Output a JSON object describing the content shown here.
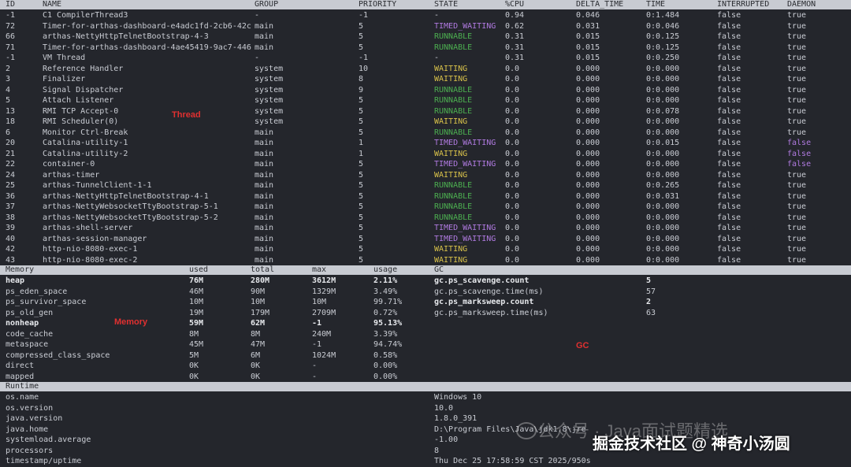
{
  "thread": {
    "headers": [
      "ID",
      "NAME",
      "GROUP",
      "PRIORITY",
      "STATE",
      "%CPU",
      "DELTA_TIME",
      "TIME",
      "INTERRUPTED",
      "DAEMON"
    ],
    "rows": [
      [
        "-1",
        "C1 CompilerThread3",
        "-",
        "-1",
        "-",
        "0.94",
        "0.046",
        "0:1.484",
        "false",
        "true"
      ],
      [
        "72",
        "Timer-for-arthas-dashboard-e4adc1fd-2cb6-42c",
        "main",
        "5",
        "TIMED_WAITING",
        "0.62",
        "0.031",
        "0:0.046",
        "false",
        "true"
      ],
      [
        "66",
        "arthas-NettyHttpTelnetBootstrap-4-3",
        "main",
        "5",
        "RUNNABLE",
        "0.31",
        "0.015",
        "0:0.125",
        "false",
        "true"
      ],
      [
        "71",
        "Timer-for-arthas-dashboard-4ae45419-9ac7-446",
        "main",
        "5",
        "RUNNABLE",
        "0.31",
        "0.015",
        "0:0.125",
        "false",
        "true"
      ],
      [
        "-1",
        "VM Thread",
        "-",
        "-1",
        "-",
        "0.31",
        "0.015",
        "0:0.250",
        "false",
        "true"
      ],
      [
        "2",
        "Reference Handler",
        "system",
        "10",
        "WAITING",
        "0.0",
        "0.000",
        "0:0.000",
        "false",
        "true"
      ],
      [
        "3",
        "Finalizer",
        "system",
        "8",
        "WAITING",
        "0.0",
        "0.000",
        "0:0.000",
        "false",
        "true"
      ],
      [
        "4",
        "Signal Dispatcher",
        "system",
        "9",
        "RUNNABLE",
        "0.0",
        "0.000",
        "0:0.000",
        "false",
        "true"
      ],
      [
        "5",
        "Attach Listener",
        "system",
        "5",
        "RUNNABLE",
        "0.0",
        "0.000",
        "0:0.000",
        "false",
        "true"
      ],
      [
        "13",
        "RMI TCP Accept-0",
        "system",
        "5",
        "RUNNABLE",
        "0.0",
        "0.000",
        "0:0.078",
        "false",
        "true"
      ],
      [
        "18",
        "RMI Scheduler(0)",
        "system",
        "5",
        "WAITING",
        "0.0",
        "0.000",
        "0:0.000",
        "false",
        "true"
      ],
      [
        "6",
        "Monitor Ctrl-Break",
        "main",
        "5",
        "RUNNABLE",
        "0.0",
        "0.000",
        "0:0.000",
        "false",
        "true"
      ],
      [
        "20",
        "Catalina-utility-1",
        "main",
        "1",
        "TIMED_WAITING",
        "0.0",
        "0.000",
        "0:0.015",
        "false",
        "false"
      ],
      [
        "21",
        "Catalina-utility-2",
        "main",
        "1",
        "WAITING",
        "0.0",
        "0.000",
        "0:0.000",
        "false",
        "false"
      ],
      [
        "22",
        "container-0",
        "main",
        "5",
        "TIMED_WAITING",
        "0.0",
        "0.000",
        "0:0.000",
        "false",
        "false"
      ],
      [
        "24",
        "arthas-timer",
        "main",
        "5",
        "WAITING",
        "0.0",
        "0.000",
        "0:0.000",
        "false",
        "true"
      ],
      [
        "25",
        "arthas-TunnelClient-1-1",
        "main",
        "5",
        "RUNNABLE",
        "0.0",
        "0.000",
        "0:0.265",
        "false",
        "true"
      ],
      [
        "36",
        "arthas-NettyHttpTelnetBootstrap-4-1",
        "main",
        "5",
        "RUNNABLE",
        "0.0",
        "0.000",
        "0:0.031",
        "false",
        "true"
      ],
      [
        "37",
        "arthas-NettyWebsocketTtyBootstrap-5-1",
        "main",
        "5",
        "RUNNABLE",
        "0.0",
        "0.000",
        "0:0.000",
        "false",
        "true"
      ],
      [
        "38",
        "arthas-NettyWebsocketTtyBootstrap-5-2",
        "main",
        "5",
        "RUNNABLE",
        "0.0",
        "0.000",
        "0:0.000",
        "false",
        "true"
      ],
      [
        "39",
        "arthas-shell-server",
        "main",
        "5",
        "TIMED_WAITING",
        "0.0",
        "0.000",
        "0:0.000",
        "false",
        "true"
      ],
      [
        "40",
        "arthas-session-manager",
        "main",
        "5",
        "TIMED_WAITING",
        "0.0",
        "0.000",
        "0:0.000",
        "false",
        "true"
      ],
      [
        "42",
        "http-nio-8080-exec-1",
        "main",
        "5",
        "WAITING",
        "0.0",
        "0.000",
        "0:0.000",
        "false",
        "true"
      ],
      [
        "43",
        "http-nio-8080-exec-2",
        "main",
        "5",
        "WAITING",
        "0.0",
        "0.000",
        "0:0.000",
        "false",
        "true"
      ]
    ],
    "label": "Thread"
  },
  "memory": {
    "headers": [
      "Memory",
      "used",
      "total",
      "max",
      "usage"
    ],
    "rows": [
      {
        "cells": [
          "heap",
          "76M",
          "280M",
          "3612M",
          "2.11%"
        ],
        "bold": true
      },
      {
        "cells": [
          "ps_eden_space",
          "46M",
          "90M",
          "1329M",
          "3.49%"
        ],
        "bold": false
      },
      {
        "cells": [
          "ps_survivor_space",
          "10M",
          "10M",
          "10M",
          "99.71%"
        ],
        "bold": false
      },
      {
        "cells": [
          "ps_old_gen",
          "19M",
          "179M",
          "2709M",
          "0.72%"
        ],
        "bold": false
      },
      {
        "cells": [
          "nonheap",
          "59M",
          "62M",
          "-1",
          "95.13%"
        ],
        "bold": true
      },
      {
        "cells": [
          "code_cache",
          "8M",
          "8M",
          "240M",
          "3.39%"
        ],
        "bold": false
      },
      {
        "cells": [
          "metaspace",
          "45M",
          "47M",
          "-1",
          "94.74%"
        ],
        "bold": false
      },
      {
        "cells": [
          "compressed_class_space",
          "5M",
          "6M",
          "1024M",
          "0.58%"
        ],
        "bold": false
      },
      {
        "cells": [
          "direct",
          "0K",
          "0K",
          "-",
          "0.00%"
        ],
        "bold": false
      },
      {
        "cells": [
          "mapped",
          "0K",
          "0K",
          "-",
          "0.00%"
        ],
        "bold": false
      }
    ],
    "label": "Memory"
  },
  "gc": {
    "header": "GC",
    "rows": [
      {
        "cells": [
          "gc.ps_scavenge.count",
          "5"
        ],
        "bold": true
      },
      {
        "cells": [
          "gc.ps_scavenge.time(ms)",
          "57"
        ],
        "bold": false
      },
      {
        "cells": [
          "gc.ps_marksweep.count",
          "2"
        ],
        "bold": true
      },
      {
        "cells": [
          "gc.ps_marksweep.time(ms)",
          "63"
        ],
        "bold": false
      }
    ],
    "label": "GC"
  },
  "runtime": {
    "header": "Runtime",
    "rows": [
      [
        "os.name",
        "Windows 10"
      ],
      [
        "os.version",
        "10.0"
      ],
      [
        "java.version",
        "1.8.0_391"
      ],
      [
        "java.home",
        "D:\\Program Files\\Java\\jdk1.8\\jre"
      ],
      [
        "systemload.average",
        "-1.00"
      ],
      [
        "processors",
        "8"
      ],
      [
        "timestamp/uptime",
        "Thu Dec 25 17:58:59 CST 2025/950s"
      ]
    ]
  },
  "watermark": {
    "line1": "公众号 · Java面试题精选",
    "line2": "掘金技术社区 @ 神奇小汤圆"
  },
  "colors": {
    "runnable": "#4caf50",
    "waiting": "#d9c24a",
    "timed_waiting": "#b07ae0",
    "label_red": "#e03030"
  }
}
